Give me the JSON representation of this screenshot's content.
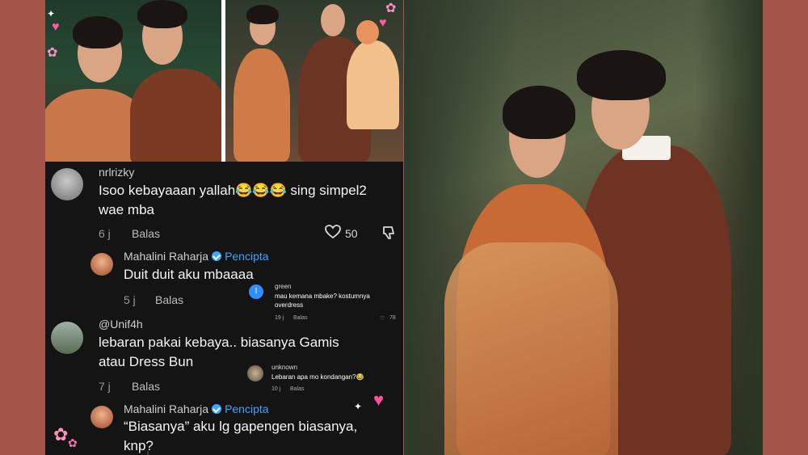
{
  "colors": {
    "frame": "#a4564a",
    "panel": "#141414",
    "accent": "#3da6ff"
  },
  "comments": [
    {
      "user": "nrlrizky",
      "text_lines": [
        "Isoo kebayaaan yallah😂😂😂 sing simpel2",
        "wae mba"
      ],
      "time": "6 j",
      "reply": "Balas",
      "likes": "50"
    },
    {
      "user": "Mahalini Raharja",
      "badge": "Pencipta",
      "text_lines": [
        "Duit duit aku mbaaaa"
      ],
      "time": "5 j",
      "reply": "Balas"
    },
    {
      "user": "@Unif4h",
      "text_lines": [
        "lebaran pakai kebaya.. biasanya Gamis",
        "atau Dress Bun"
      ],
      "time": "7 j",
      "reply": "Balas"
    },
    {
      "user": "Mahalini Raharja",
      "badge": "Pencipta",
      "text_lines": [
        "“Biasanya” aku lg gapengen biasanya,",
        "knp?"
      ]
    }
  ],
  "overlay_comments": [
    {
      "user": "green",
      "text_lines": [
        "mau kemana mbake? kostumnya",
        "overdress"
      ],
      "time": "19 j",
      "reply": "Balas",
      "likes": "78",
      "avatar_letter": "I"
    },
    {
      "user": "unknown",
      "text_lines": [
        "Lebaran apa mo kondangan?😂"
      ],
      "time": "10 j",
      "reply": "Balas"
    }
  ],
  "icons": [
    "heart-icon",
    "dislike-icon",
    "verified-icon",
    "sparkle-icon",
    "flower-icon"
  ]
}
